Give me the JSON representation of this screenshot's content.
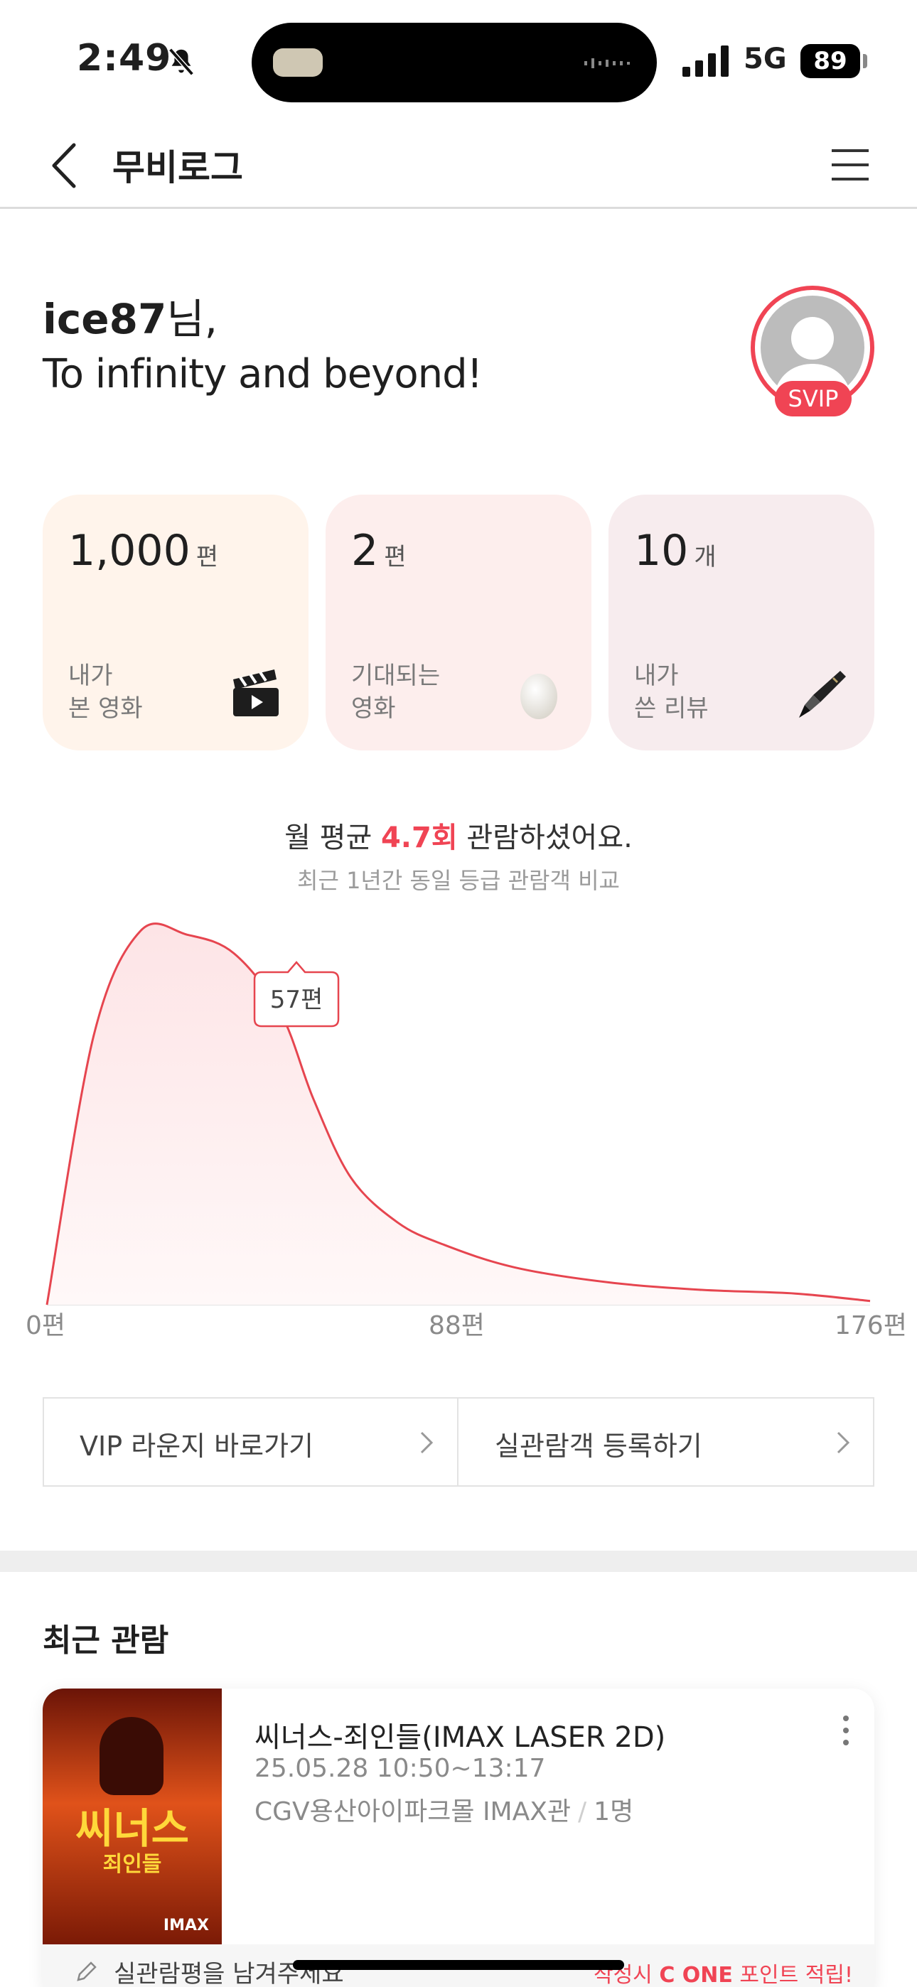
{
  "status_bar": {
    "time": "2:49",
    "network": "5G",
    "battery": "89"
  },
  "nav": {
    "title": "무비로그"
  },
  "greeting": {
    "name": "ice87",
    "suffix": "님,",
    "message": "To infinity and beyond!"
  },
  "profile": {
    "badge": "SVIP"
  },
  "stats": [
    {
      "value": "1,000",
      "unit": "편",
      "label": "내가\n본 영화",
      "icon": "clapperboard-icon"
    },
    {
      "value": "2",
      "unit": "편",
      "label": "기대되는\n영화",
      "icon": "egg-icon"
    },
    {
      "value": "10",
      "unit": "개",
      "label": "내가\n쓴 리뷰",
      "icon": "fountain-pen-icon"
    }
  ],
  "summary": {
    "prefix": "월 평균 ",
    "highlight": "4.7회",
    "suffix": " 관람하셨어요.",
    "sub": "최근 1년간 동일 등급 관람객 비교"
  },
  "chart_data": {
    "type": "area",
    "x_ticks": [
      "0편",
      "88편",
      "176편"
    ],
    "xlim": [
      0,
      176
    ],
    "marker": {
      "x": 57,
      "label": "57편"
    },
    "series": [
      {
        "x": [
          0,
          10,
          20,
          30,
          40,
          50,
          57,
          65,
          75,
          85,
          100,
          120,
          140,
          160,
          176
        ],
        "y": [
          0,
          0.72,
          1.0,
          0.99,
          0.94,
          0.78,
          0.55,
          0.34,
          0.22,
          0.16,
          0.1,
          0.06,
          0.04,
          0.03,
          0.01
        ]
      }
    ],
    "colors": {
      "line": "#e6454f",
      "fill_top": "#fde4e6",
      "fill_bottom": "#fff8f8"
    }
  },
  "links": [
    {
      "label": "VIP 라운지 바로가기"
    },
    {
      "label": "실관람객 등록하기"
    }
  ],
  "recent": {
    "section_title": "최근 관람",
    "movie": {
      "poster_title": "씨너스",
      "poster_subtitle": "죄인들",
      "poster_badge": "IMAX",
      "title": "씨너스-죄인들(IMAX LASER 2D)",
      "datetime": "25.05.28 10:50~13:17",
      "theater": "CGV용산아이파크몰 IMAX관",
      "people": "1명"
    },
    "review_prompt": "실관람평을 남겨주세요",
    "review_promo_prefix": "작성시 ",
    "review_promo_brand": "C ONE",
    "review_promo_suffix": " 포인트 적립!"
  },
  "colors": {
    "accent": "#f04454"
  }
}
